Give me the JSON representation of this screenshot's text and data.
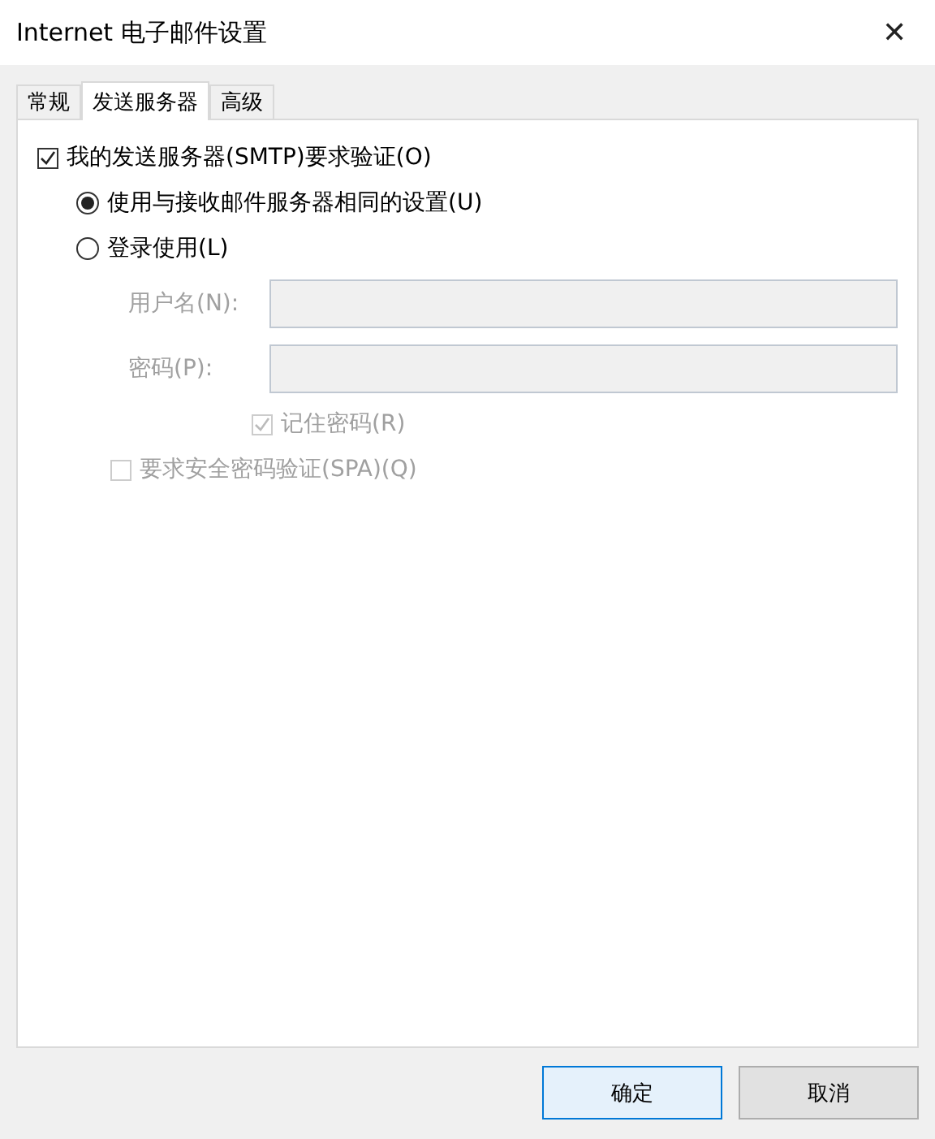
{
  "window": {
    "title": "Internet 电子邮件设置",
    "close": "✕"
  },
  "tabs": [
    {
      "label": "常规",
      "selected": false
    },
    {
      "label": "发送服务器",
      "selected": true
    },
    {
      "label": "高级",
      "selected": false
    }
  ],
  "smtp_auth": {
    "label": "我的发送服务器(SMTP)要求验证(O)",
    "checked": true,
    "disabled": false
  },
  "auth_options": [
    {
      "label": "使用与接收邮件服务器相同的设置(U)",
      "selected": true
    },
    {
      "label": "登录使用(L)",
      "selected": false
    }
  ],
  "login_fields": [
    {
      "label": "用户名(N):",
      "disabled": true
    },
    {
      "label": "密码(P):",
      "disabled": true
    }
  ],
  "remember_password": {
    "label": "记住密码(R)",
    "checked": true,
    "disabled": true
  },
  "spa": {
    "label": "要求安全密码验证(SPA)(Q)",
    "checked": false,
    "disabled": true
  },
  "buttons": [
    {
      "label": "确定",
      "default": true
    },
    {
      "label": "取消",
      "default": false
    }
  ]
}
